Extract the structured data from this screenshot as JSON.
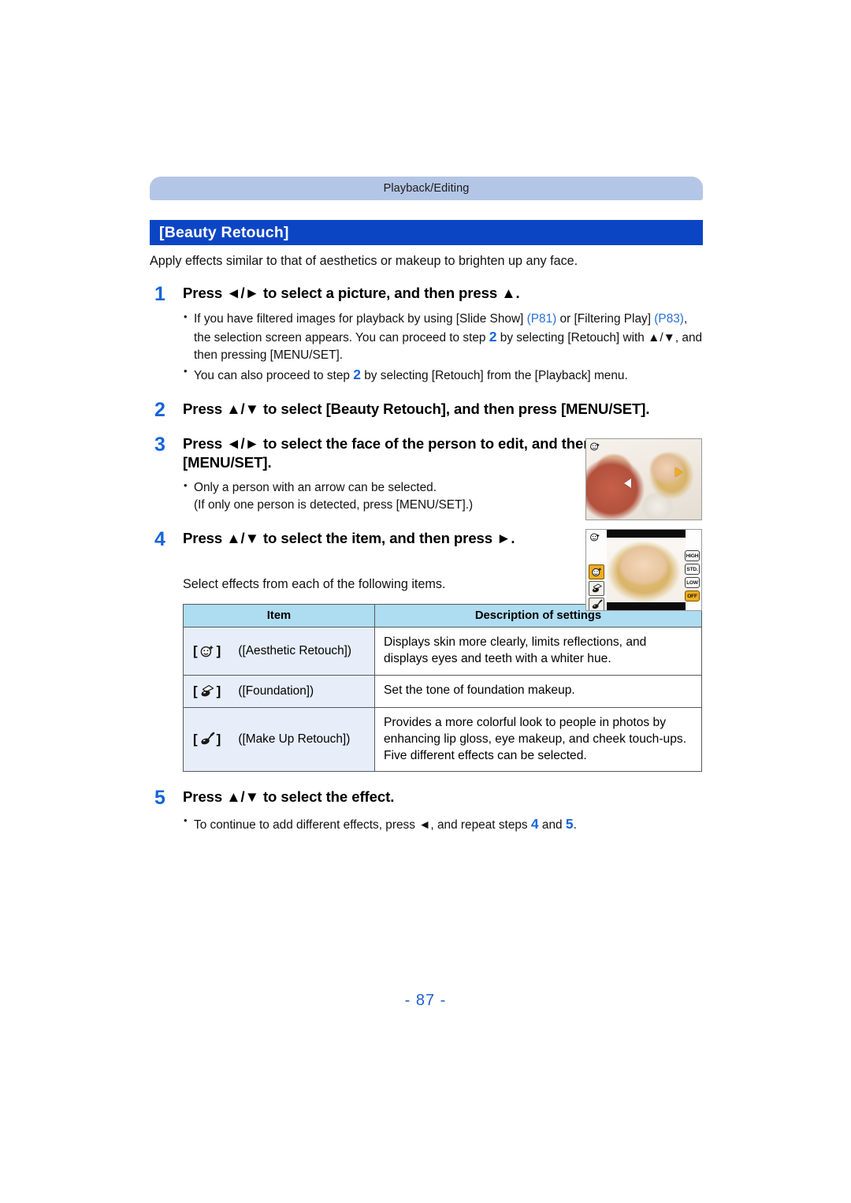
{
  "page": {
    "category_banner": "Playback/Editing",
    "title": "[Beauty Retouch]",
    "intro": "Apply effects similar to that of aesthetics or makeup to brighten up any face.",
    "folio": "- 87 -"
  },
  "steps": [
    {
      "number": "1",
      "heading": "Press ◄/► to select a picture, and then press ▲.",
      "bullets": [
        {
          "parts": [
            {
              "t": "If you have filtered images for playback by using [Slide Show] ",
              "style": "normal"
            },
            {
              "t": "(P81)",
              "style": "pageref"
            },
            {
              "t": " or [Filtering Play] ",
              "style": "normal"
            },
            {
              "t": "(P83)",
              "style": "pageref"
            },
            {
              "t": ", the selection screen appears. You can proceed to step ",
              "style": "normal"
            },
            {
              "t": "2",
              "style": "stepref"
            },
            {
              "t": " by selecting [Retouch] with ▲/▼, and then pressing [MENU/SET].",
              "style": "normal"
            }
          ]
        },
        {
          "parts": [
            {
              "t": "You can also proceed to step ",
              "style": "normal"
            },
            {
              "t": "2",
              "style": "stepref"
            },
            {
              "t": " by selecting [Retouch] from the [Playback] menu.",
              "style": "normal"
            }
          ]
        }
      ]
    },
    {
      "number": "2",
      "heading": "Press ▲/▼ to select [Beauty Retouch], and then press [MENU/SET].",
      "bullets": []
    },
    {
      "number": "3",
      "heading": "Press ◄/► to select the face of the person to edit, and then press [MENU/SET].",
      "bullets": [
        {
          "parts": [
            {
              "t": "Only a person with an arrow can be selected.",
              "style": "normal"
            },
            {
              "t": "(If only one person is detected, press [MENU/SET].)",
              "style": "newline"
            }
          ]
        }
      ]
    },
    {
      "number": "4",
      "heading": "Press ▲/▼ to select the item, and then press ►.",
      "bullets": []
    },
    {
      "number": "5",
      "heading": "Press ▲/▼ to select the effect.",
      "bullets": [
        {
          "parts": [
            {
              "t": "To continue to add different effects, press ◄, and repeat steps ",
              "style": "normal"
            },
            {
              "t": "4",
              "style": "stepref"
            },
            {
              "t": " and ",
              "style": "normal"
            },
            {
              "t": "5",
              "style": "stepref"
            },
            {
              "t": ".",
              "style": "normal"
            }
          ]
        }
      ]
    }
  ],
  "table_intro": "Select effects from each of the following items.",
  "table": {
    "headers": [
      "Item",
      "Description of settings"
    ],
    "rows": [
      {
        "icon": "smiley-sparkle-icon",
        "item_label": "([Aesthetic Retouch])",
        "description": "Displays skin more clearly, limits reflections, and displays eyes and teeth with a whiter hue."
      },
      {
        "icon": "powder-puff-icon",
        "item_label": "([Foundation])",
        "description": "Set the tone of foundation makeup."
      },
      {
        "icon": "makeup-brush-icon",
        "item_label": "([Make Up Retouch])",
        "description": "Provides a more colorful look to people in photos by enhancing lip gloss, eye makeup, and cheek touch-ups. Five different effects can be selected."
      }
    ]
  },
  "screenshots": {
    "face_select": {
      "badge_icon": "beauty-retouch-badge-icon",
      "left_arrow_icon": "arrow-left-white-icon",
      "right_arrow_icon": "arrow-right-orange-icon"
    },
    "effect_select": {
      "badge_icon": "beauty-retouch-badge-icon",
      "side_items": [
        {
          "icon": "smiley-sparkle-icon",
          "selected": true
        },
        {
          "icon": "powder-puff-icon",
          "selected": false
        },
        {
          "icon": "makeup-brush-icon",
          "selected": false
        }
      ],
      "levels": [
        {
          "label": "HIGH",
          "selected": false
        },
        {
          "label": "STD.",
          "selected": false
        },
        {
          "label": "LOW",
          "selected": false
        },
        {
          "label": "OFF",
          "selected": true
        }
      ]
    }
  },
  "colors": {
    "banner": "#b4c6e6",
    "title_bar": "#0c45c4",
    "table_header": "#aedcf0",
    "item_cell": "#e7eefa",
    "accent_blue": "#1464dc",
    "page_ref": "#2a6fd6",
    "highlight_orange": "#f0ad1e"
  }
}
